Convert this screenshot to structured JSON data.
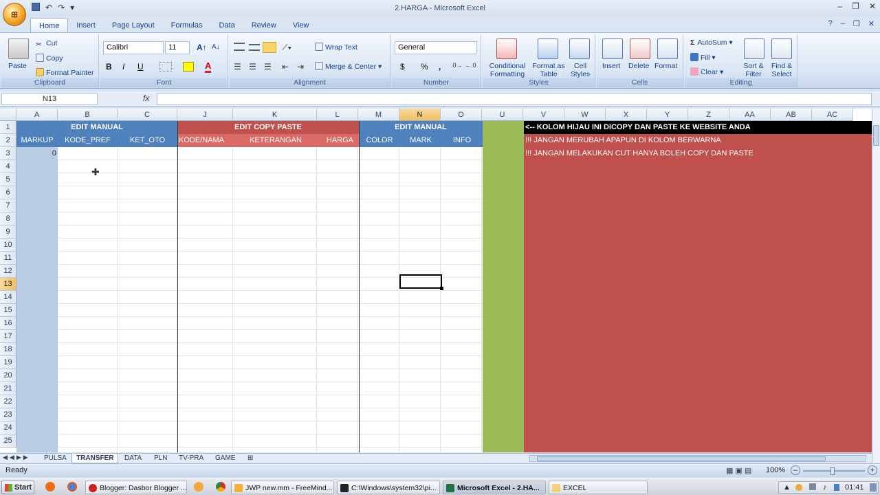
{
  "window": {
    "title": "2.HARGA - Microsoft Excel"
  },
  "tabs": [
    "Home",
    "Insert",
    "Page Layout",
    "Formulas",
    "Data",
    "Review",
    "View"
  ],
  "ribbon": {
    "clipboard": {
      "label": "Clipboard",
      "paste": "Paste",
      "cut": "Cut",
      "copy": "Copy",
      "format_painter": "Format Painter"
    },
    "font": {
      "label": "Font",
      "name": "Calibri",
      "size": "11",
      "bold": "B",
      "italic": "I",
      "underline": "U"
    },
    "alignment": {
      "label": "Alignment",
      "wrap_text": "Wrap Text",
      "merge": "Merge & Center"
    },
    "number": {
      "label": "Number",
      "format": "General",
      "currency": "$",
      "percent": "%",
      "comma": ","
    },
    "styles": {
      "label": "Styles",
      "conditional": "Conditional Formatting",
      "format_table": "Format as Table",
      "cell_styles": "Cell Styles"
    },
    "cells": {
      "label": "Cells",
      "insert": "Insert",
      "delete": "Delete",
      "format": "Format"
    },
    "editing": {
      "label": "Editing",
      "autosum": "AutoSum",
      "fill": "Fill",
      "clear": "Clear",
      "sort": "Sort & Filter",
      "find": "Find & Select"
    }
  },
  "formula": {
    "name_box": "N13",
    "fx": "fx",
    "value": ""
  },
  "columns": [
    "A",
    "B",
    "C",
    "J",
    "K",
    "L",
    "M",
    "N",
    "O",
    "U",
    "V",
    "W",
    "X",
    "Y",
    "Z",
    "AA",
    "AB",
    "AC"
  ],
  "rows": [
    "1",
    "2",
    "3",
    "4",
    "5",
    "6",
    "7",
    "8",
    "9",
    "10",
    "11",
    "12",
    "13",
    "14",
    "15",
    "16",
    "17",
    "18",
    "19",
    "20",
    "21",
    "22",
    "23",
    "24",
    "25"
  ],
  "sheet": {
    "headers_row1": {
      "edit_manual_1": "EDIT MANUAL",
      "edit_copy": "EDIT COPY PASTE",
      "edit_manual_2": "EDIT MANUAL",
      "notice": "<-- KOLOM HIJAU INI DICOPY DAN PASTE KE WEBSITE ANDA"
    },
    "headers_row2": {
      "a": "MARKUP",
      "b": "KODE_PREF",
      "c": "KET_OTO",
      "j": "KODE/NAMA",
      "k": "KETERANGAN",
      "l": "HARGA",
      "m": "COLOR",
      "n": "MARK",
      "o": "INFO"
    },
    "warning_1": "!!! JANGAN MERUBAH APAPUN DI KOLOM BERWARNA",
    "warning_2": "!!! JANGAN MELAKUKAN CUT HANYA BOLEH COPY DAN PASTE",
    "a3": "0"
  },
  "sheet_tabs": [
    "PULSA",
    "TRANSFER",
    "DATA",
    "PLN",
    "TV-PRA",
    "GAME"
  ],
  "active_sheet": "TRANSFER",
  "status": {
    "ready": "Ready",
    "zoom": "100%"
  },
  "taskbar": {
    "start": "Start",
    "items": [
      "Blogger: Dasbor Blogger ...",
      "JWP new.mm - FreeMind...",
      "C:\\Windows\\system32\\pi...",
      "Microsoft Excel - 2.HA...",
      "EXCEL"
    ],
    "time": "01:41"
  },
  "colors": {
    "blue_header": "#4f81bd",
    "red_header": "#c0504d",
    "green": "#9bbb59",
    "black": "#000000"
  }
}
